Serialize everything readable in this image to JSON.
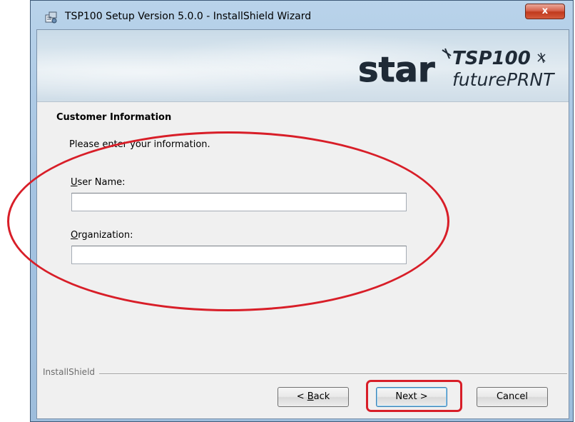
{
  "window": {
    "title": "TSP100 Setup Version 5.0.0 - InstallShield Wizard",
    "close_label": "x"
  },
  "banner": {
    "brand": "star",
    "product": "TSP100",
    "product_sub": "futurePRNT"
  },
  "page": {
    "section_title": "Customer Information",
    "instruction": "Please enter your information."
  },
  "form": {
    "user_name": {
      "label_mnemonic": "U",
      "label_rest": "ser Name:",
      "value": ""
    },
    "organization": {
      "label_mnemonic": "O",
      "label_rest": "rganization:",
      "value": ""
    }
  },
  "footer": {
    "brand_label": "InstallShield",
    "back": {
      "prefix": "< ",
      "mnemonic": "B",
      "rest": "ack"
    },
    "next_label": "Next >",
    "cancel_label": "Cancel"
  },
  "colors": {
    "annotation": "#d81e28",
    "accent": "#3c7fb1"
  },
  "icons": [
    "installer-app-icon",
    "close-icon",
    "star-logo-icon"
  ]
}
